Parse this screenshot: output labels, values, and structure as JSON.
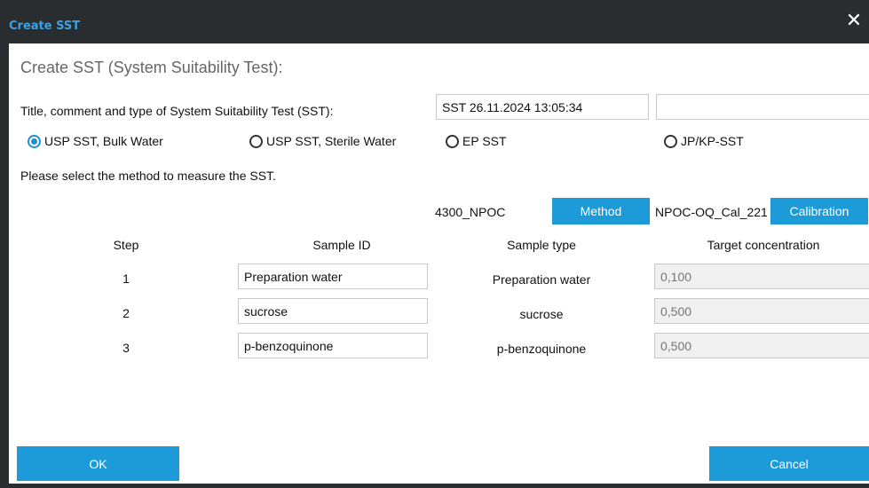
{
  "window": {
    "title": "Create SST",
    "close_glyph": "✕"
  },
  "heading": "Create SST (System Suitability Test):",
  "title_row": {
    "label": "Title, comment and type of System Suitability Test (SST):",
    "title_value": "SST 26.11.2024 13:05:34",
    "comment_value": ""
  },
  "sst_types": [
    {
      "label": "USP SST, Bulk Water",
      "selected": true
    },
    {
      "label": "USP SST, Sterile Water",
      "selected": false
    },
    {
      "label": "EP SST",
      "selected": false
    },
    {
      "label": "JP/KP-SST",
      "selected": false
    }
  ],
  "method_prompt": "Please select the method to measure the SST.",
  "method": {
    "name": "4300_NPOC",
    "button": "Method"
  },
  "calibration": {
    "name": "NPOC-OQ_Cal_221",
    "button": "Calibration"
  },
  "table": {
    "headers": [
      "Step",
      "Sample ID",
      "Sample type",
      "Target concentration"
    ],
    "rows": [
      {
        "step": "1",
        "sample_id": "Preparation water",
        "sample_type": "Preparation water",
        "target": "0,100"
      },
      {
        "step": "2",
        "sample_id": "sucrose",
        "sample_type": "sucrose",
        "target": "0,500"
      },
      {
        "step": "3",
        "sample_id": "p-benzoquinone",
        "sample_type": "p-benzoquinone",
        "target": "0,500"
      }
    ]
  },
  "buttons": {
    "ok": "OK",
    "cancel": "Cancel"
  },
  "colors": {
    "accent": "#1d9ad8",
    "titlebar": "#2a2d30",
    "title_text": "#3aa3e6"
  }
}
